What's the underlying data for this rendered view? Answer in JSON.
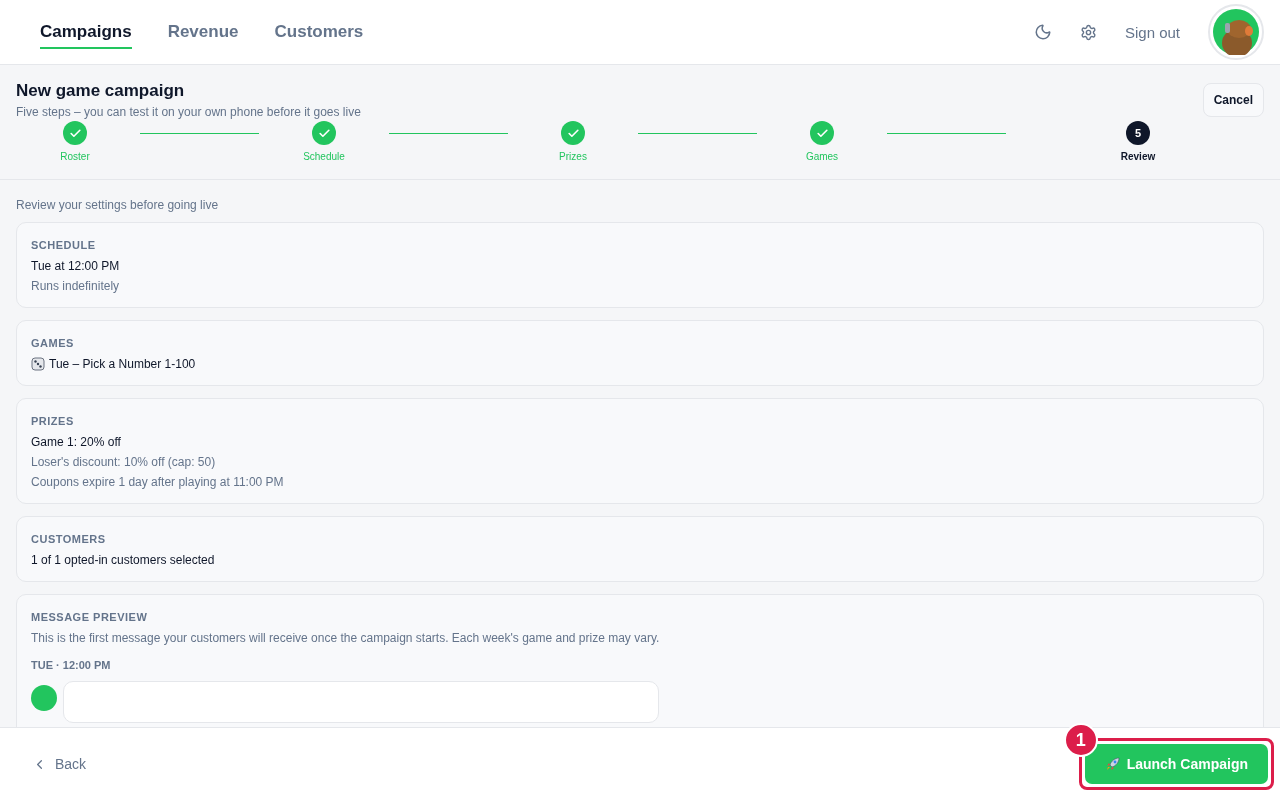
{
  "nav": {
    "tabs": [
      {
        "label": "Campaigns",
        "selected": true
      },
      {
        "label": "Revenue",
        "selected": false
      },
      {
        "label": "Customers",
        "selected": false
      }
    ],
    "sign_out": "Sign out"
  },
  "page": {
    "title": "New game campaign",
    "subtitle": "Five steps – you can test it on your own phone before it goes live",
    "cancel": "Cancel"
  },
  "steps": [
    {
      "label": "Roster",
      "done": true
    },
    {
      "label": "Schedule",
      "done": true
    },
    {
      "label": "Prizes",
      "done": true
    },
    {
      "label": "Games",
      "done": true
    },
    {
      "label": "Review",
      "done": false,
      "number": "5"
    }
  ],
  "intro": "Review your settings before going live",
  "sections": [
    {
      "kind": "lines",
      "title": "SCHEDULE",
      "lines": [
        {
          "text": "Tue at 12:00 PM",
          "muted": false
        },
        {
          "text": "Runs indefinitely",
          "muted": true
        }
      ]
    },
    {
      "kind": "game",
      "title": "GAMES",
      "lines": [
        {
          "text": "Tue – Pick a Number 1-100",
          "muted": false
        }
      ]
    },
    {
      "kind": "lines",
      "title": "PRIZES",
      "lines": [
        {
          "text": "Game 1: 20% off",
          "muted": false
        },
        {
          "text": "Loser's discount: 10% off (cap: 50)",
          "muted": true
        },
        {
          "text": "Coupons expire 1 day after playing at 11:00 PM",
          "muted": true
        }
      ]
    },
    {
      "kind": "lines",
      "title": "CUSTOMERS",
      "lines": [
        {
          "text": "1 of 1 opted-in customers selected",
          "muted": false
        }
      ]
    },
    {
      "kind": "preview",
      "title": "MESSAGE PREVIEW",
      "lines": [
        {
          "text": "This is the first message your customers will receive once the campaign starts. Each week's game and prize may vary.",
          "muted": true
        }
      ],
      "time": "TUE · 12:00 PM"
    }
  ],
  "footer": {
    "back": "Back",
    "launch": "Launch Campaign"
  },
  "annotation": {
    "label": "1"
  }
}
